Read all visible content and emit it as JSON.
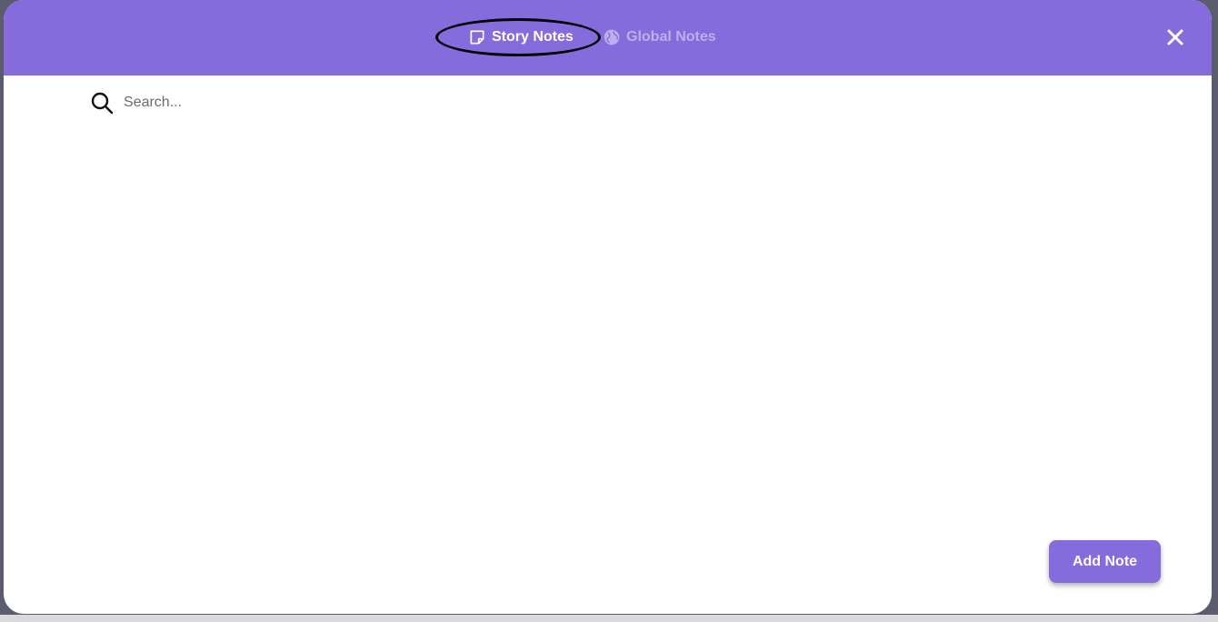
{
  "header": {
    "tabs": [
      {
        "label": "Story Notes",
        "icon": "sticky-note-icon",
        "active": true
      },
      {
        "label": "Global Notes",
        "icon": "globe-icon",
        "active": false
      }
    ],
    "close_icon": "close-icon"
  },
  "search": {
    "placeholder": "Search...",
    "value": "",
    "icon": "search-icon"
  },
  "actions": {
    "add_note_label": "Add Note"
  },
  "colors": {
    "accent": "#866bdc",
    "inactive_tab": "#bdb0ea",
    "backdrop": "#5b5c6e"
  }
}
